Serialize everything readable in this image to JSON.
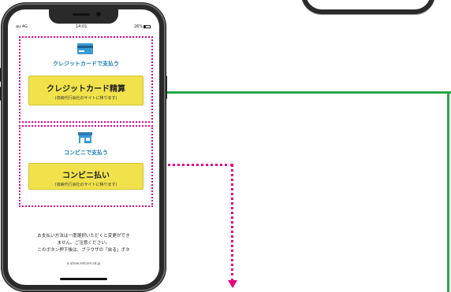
{
  "statusbar": {
    "carrier": "au 4G",
    "time": "14:01",
    "battery": "26%"
  },
  "card_section": {
    "label": "クレジットカードで支払う",
    "button_main": "クレジットカード精算",
    "button_sub": "(収納代行会社のサイトに移ります)",
    "icon": "credit-card-icon"
  },
  "convenience_section": {
    "label": "コンビニで支払う",
    "button_main": "コンビニ払い",
    "button_sub": "(収納代行会社のサイトに移ります)",
    "icon": "convenience-store-icon"
  },
  "footer": {
    "line1": "お支払い方法は一度選択いただくと変更ができ",
    "line2": "ません。ご注意ください。",
    "line3": "このボタン押下後は、ブラウザの「戻る」ボタ",
    "url": "a.utrew.netcom.ad.jp"
  },
  "colors": {
    "accent_pink": "#e6007e",
    "connector_green": "#25a948",
    "button_yellow": "#f1e24b",
    "label_blue": "#1a7fb4"
  }
}
